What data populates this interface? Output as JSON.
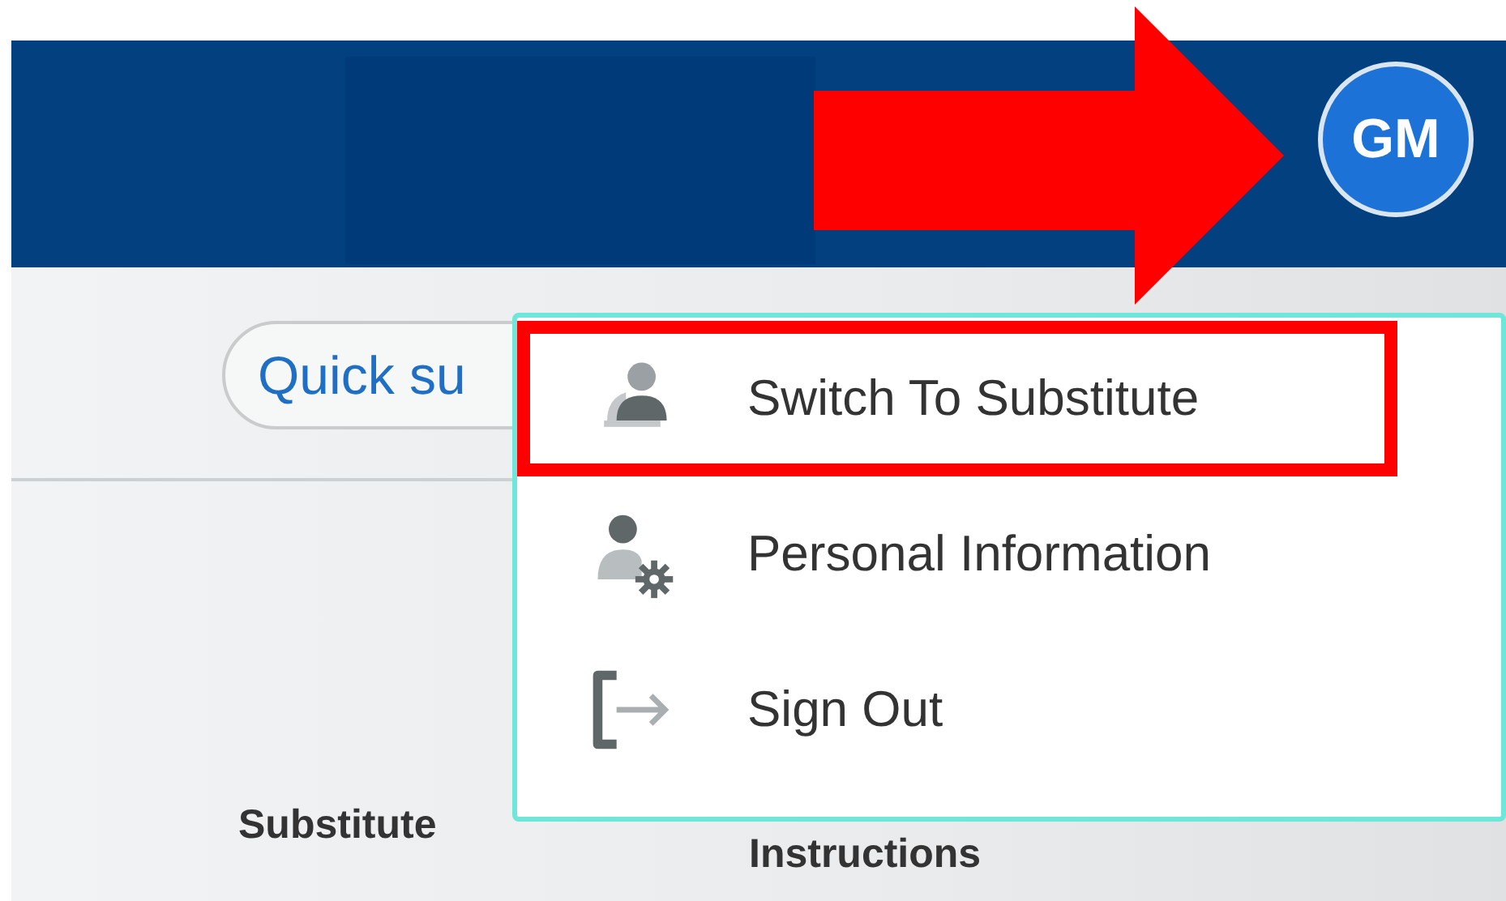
{
  "header": {
    "avatar": {
      "initials": "GM"
    }
  },
  "quick_search": {
    "label": "Quick su"
  },
  "columns": [
    "Substitute",
    "Instructions"
  ],
  "user_menu": {
    "items": [
      {
        "label": "Switch To Substitute",
        "kind": "substitute",
        "highlighted": true
      },
      {
        "label": "Personal Information",
        "kind": "personal",
        "highlighted": false
      },
      {
        "label": "Sign Out",
        "kind": "signout",
        "highlighted": false
      }
    ]
  },
  "annotation": {
    "arrow": true
  }
}
